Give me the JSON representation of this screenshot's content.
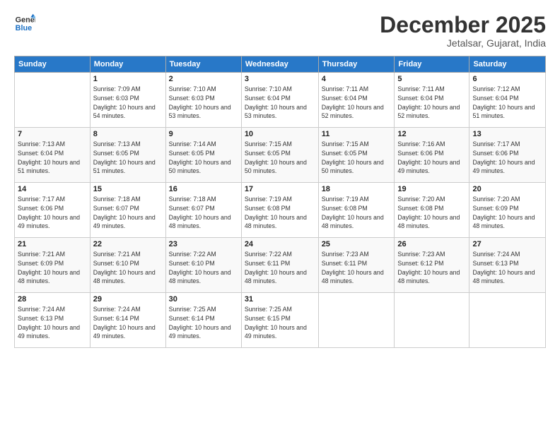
{
  "header": {
    "logo_line1": "General",
    "logo_line2": "Blue",
    "month": "December 2025",
    "location": "Jetalsar, Gujarat, India"
  },
  "days_of_week": [
    "Sunday",
    "Monday",
    "Tuesday",
    "Wednesday",
    "Thursday",
    "Friday",
    "Saturday"
  ],
  "weeks": [
    [
      {
        "num": "",
        "empty": true
      },
      {
        "num": "1",
        "sunrise": "Sunrise: 7:09 AM",
        "sunset": "Sunset: 6:03 PM",
        "daylight": "Daylight: 10 hours and 54 minutes."
      },
      {
        "num": "2",
        "sunrise": "Sunrise: 7:10 AM",
        "sunset": "Sunset: 6:03 PM",
        "daylight": "Daylight: 10 hours and 53 minutes."
      },
      {
        "num": "3",
        "sunrise": "Sunrise: 7:10 AM",
        "sunset": "Sunset: 6:04 PM",
        "daylight": "Daylight: 10 hours and 53 minutes."
      },
      {
        "num": "4",
        "sunrise": "Sunrise: 7:11 AM",
        "sunset": "Sunset: 6:04 PM",
        "daylight": "Daylight: 10 hours and 52 minutes."
      },
      {
        "num": "5",
        "sunrise": "Sunrise: 7:11 AM",
        "sunset": "Sunset: 6:04 PM",
        "daylight": "Daylight: 10 hours and 52 minutes."
      },
      {
        "num": "6",
        "sunrise": "Sunrise: 7:12 AM",
        "sunset": "Sunset: 6:04 PM",
        "daylight": "Daylight: 10 hours and 51 minutes."
      }
    ],
    [
      {
        "num": "7",
        "sunrise": "Sunrise: 7:13 AM",
        "sunset": "Sunset: 6:04 PM",
        "daylight": "Daylight: 10 hours and 51 minutes."
      },
      {
        "num": "8",
        "sunrise": "Sunrise: 7:13 AM",
        "sunset": "Sunset: 6:05 PM",
        "daylight": "Daylight: 10 hours and 51 minutes."
      },
      {
        "num": "9",
        "sunrise": "Sunrise: 7:14 AM",
        "sunset": "Sunset: 6:05 PM",
        "daylight": "Daylight: 10 hours and 50 minutes."
      },
      {
        "num": "10",
        "sunrise": "Sunrise: 7:15 AM",
        "sunset": "Sunset: 6:05 PM",
        "daylight": "Daylight: 10 hours and 50 minutes."
      },
      {
        "num": "11",
        "sunrise": "Sunrise: 7:15 AM",
        "sunset": "Sunset: 6:05 PM",
        "daylight": "Daylight: 10 hours and 50 minutes."
      },
      {
        "num": "12",
        "sunrise": "Sunrise: 7:16 AM",
        "sunset": "Sunset: 6:06 PM",
        "daylight": "Daylight: 10 hours and 49 minutes."
      },
      {
        "num": "13",
        "sunrise": "Sunrise: 7:17 AM",
        "sunset": "Sunset: 6:06 PM",
        "daylight": "Daylight: 10 hours and 49 minutes."
      }
    ],
    [
      {
        "num": "14",
        "sunrise": "Sunrise: 7:17 AM",
        "sunset": "Sunset: 6:06 PM",
        "daylight": "Daylight: 10 hours and 49 minutes."
      },
      {
        "num": "15",
        "sunrise": "Sunrise: 7:18 AM",
        "sunset": "Sunset: 6:07 PM",
        "daylight": "Daylight: 10 hours and 49 minutes."
      },
      {
        "num": "16",
        "sunrise": "Sunrise: 7:18 AM",
        "sunset": "Sunset: 6:07 PM",
        "daylight": "Daylight: 10 hours and 48 minutes."
      },
      {
        "num": "17",
        "sunrise": "Sunrise: 7:19 AM",
        "sunset": "Sunset: 6:08 PM",
        "daylight": "Daylight: 10 hours and 48 minutes."
      },
      {
        "num": "18",
        "sunrise": "Sunrise: 7:19 AM",
        "sunset": "Sunset: 6:08 PM",
        "daylight": "Daylight: 10 hours and 48 minutes."
      },
      {
        "num": "19",
        "sunrise": "Sunrise: 7:20 AM",
        "sunset": "Sunset: 6:08 PM",
        "daylight": "Daylight: 10 hours and 48 minutes."
      },
      {
        "num": "20",
        "sunrise": "Sunrise: 7:20 AM",
        "sunset": "Sunset: 6:09 PM",
        "daylight": "Daylight: 10 hours and 48 minutes."
      }
    ],
    [
      {
        "num": "21",
        "sunrise": "Sunrise: 7:21 AM",
        "sunset": "Sunset: 6:09 PM",
        "daylight": "Daylight: 10 hours and 48 minutes."
      },
      {
        "num": "22",
        "sunrise": "Sunrise: 7:21 AM",
        "sunset": "Sunset: 6:10 PM",
        "daylight": "Daylight: 10 hours and 48 minutes."
      },
      {
        "num": "23",
        "sunrise": "Sunrise: 7:22 AM",
        "sunset": "Sunset: 6:10 PM",
        "daylight": "Daylight: 10 hours and 48 minutes."
      },
      {
        "num": "24",
        "sunrise": "Sunrise: 7:22 AM",
        "sunset": "Sunset: 6:11 PM",
        "daylight": "Daylight: 10 hours and 48 minutes."
      },
      {
        "num": "25",
        "sunrise": "Sunrise: 7:23 AM",
        "sunset": "Sunset: 6:11 PM",
        "daylight": "Daylight: 10 hours and 48 minutes."
      },
      {
        "num": "26",
        "sunrise": "Sunrise: 7:23 AM",
        "sunset": "Sunset: 6:12 PM",
        "daylight": "Daylight: 10 hours and 48 minutes."
      },
      {
        "num": "27",
        "sunrise": "Sunrise: 7:24 AM",
        "sunset": "Sunset: 6:13 PM",
        "daylight": "Daylight: 10 hours and 48 minutes."
      }
    ],
    [
      {
        "num": "28",
        "sunrise": "Sunrise: 7:24 AM",
        "sunset": "Sunset: 6:13 PM",
        "daylight": "Daylight: 10 hours and 49 minutes."
      },
      {
        "num": "29",
        "sunrise": "Sunrise: 7:24 AM",
        "sunset": "Sunset: 6:14 PM",
        "daylight": "Daylight: 10 hours and 49 minutes."
      },
      {
        "num": "30",
        "sunrise": "Sunrise: 7:25 AM",
        "sunset": "Sunset: 6:14 PM",
        "daylight": "Daylight: 10 hours and 49 minutes."
      },
      {
        "num": "31",
        "sunrise": "Sunrise: 7:25 AM",
        "sunset": "Sunset: 6:15 PM",
        "daylight": "Daylight: 10 hours and 49 minutes."
      },
      {
        "num": "",
        "empty": true
      },
      {
        "num": "",
        "empty": true
      },
      {
        "num": "",
        "empty": true
      }
    ]
  ]
}
